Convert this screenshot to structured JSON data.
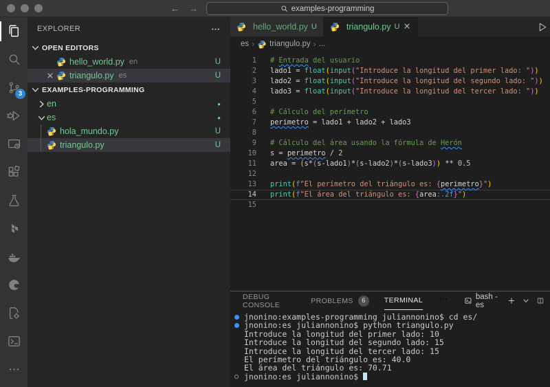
{
  "colors": {
    "untracked_green": "#73C991",
    "badge_blue": "#2F86D1",
    "squiggle_info_blue": "#3794FF",
    "terminal_decoration_blue": "#3794ff",
    "comment": "#6A9955",
    "string": "#CE9178",
    "builtin_function": "#4EC9B0",
    "number": "#B5CEA8",
    "bracket_level1": "#FFD700",
    "bracket_level2": "#DA70D6",
    "fstring_prefix": "#569CD6"
  },
  "title_bar": {
    "search_value": "examples-programming"
  },
  "activity_bar": {
    "items": [
      {
        "name": "explorer",
        "icon": "files",
        "active": true
      },
      {
        "name": "search",
        "icon": "search"
      },
      {
        "name": "source-control",
        "icon": "source-control",
        "badge": "3"
      },
      {
        "name": "run-and-debug",
        "icon": "debug"
      },
      {
        "name": "remote-explorer",
        "icon": "remote"
      },
      {
        "name": "extensions",
        "icon": "extensions"
      },
      {
        "name": "testing",
        "icon": "beaker"
      },
      {
        "name": "terraform",
        "icon": "terraform"
      },
      {
        "name": "docker",
        "icon": "docker"
      },
      {
        "name": "edge-tools",
        "icon": "edge"
      },
      {
        "name": "code-runner",
        "icon": "file-gear"
      },
      {
        "name": "external-terminal",
        "icon": "terminal-box"
      },
      {
        "name": "more-views",
        "icon": "ellipsis"
      }
    ]
  },
  "sidebar": {
    "title": "EXPLORER",
    "open_editors": {
      "label": "OPEN EDITORS",
      "rows": [
        {
          "file": "hello_world.py",
          "desc": "en",
          "badge": "U",
          "selected": false
        },
        {
          "file": "triangulo.py",
          "desc": "es",
          "badge": "U",
          "selected": true,
          "close": true
        }
      ]
    },
    "workspace": {
      "label": "EXAMPLES-PROGRAMMING",
      "rows": [
        {
          "kind": "folder",
          "file": "en",
          "expanded": false,
          "badge": "●"
        },
        {
          "kind": "folder",
          "file": "es",
          "expanded": true,
          "badge": "●"
        },
        {
          "kind": "file",
          "file": "hola_mundo.py",
          "badge": "U",
          "child": true
        },
        {
          "kind": "file",
          "file": "triangulo.py",
          "badge": "U",
          "child": true,
          "selected": true
        }
      ]
    }
  },
  "editor": {
    "tabs": [
      {
        "label": "hello_world.py",
        "badge": "U",
        "active": false
      },
      {
        "label": "triangulo.py",
        "badge": "U",
        "active": true,
        "close": true
      }
    ],
    "breadcrumb": [
      "es",
      "triangulo.py",
      "..."
    ],
    "current_line": 14,
    "code_lines": [
      {
        "n": 1,
        "tokens": [
          [
            "# ",
            "cm"
          ],
          [
            "Entrada",
            "cm",
            true
          ],
          [
            " del usuario",
            "cm"
          ]
        ]
      },
      {
        "n": 2,
        "tokens": [
          [
            "lado1 = ",
            "v"
          ],
          [
            "float",
            "fn"
          ],
          [
            "(",
            "b1"
          ],
          [
            "input",
            "fn"
          ],
          [
            "(",
            "b2"
          ],
          [
            "\"Introduce la longitud del primer lado: \"",
            "str"
          ],
          [
            ")",
            "b2"
          ],
          [
            ")",
            "b1"
          ]
        ]
      },
      {
        "n": 3,
        "tokens": [
          [
            "lado2 = ",
            "v"
          ],
          [
            "float",
            "fn"
          ],
          [
            "(",
            "b1"
          ],
          [
            "input",
            "fn"
          ],
          [
            "(",
            "b2"
          ],
          [
            "\"Introduce la longitud del segundo lado: \"",
            "str"
          ],
          [
            ")",
            "b2"
          ],
          [
            ")",
            "b1"
          ]
        ]
      },
      {
        "n": 4,
        "tokens": [
          [
            "lado3 = ",
            "v"
          ],
          [
            "float",
            "fn"
          ],
          [
            "(",
            "b1"
          ],
          [
            "input",
            "fn"
          ],
          [
            "(",
            "b2"
          ],
          [
            "\"Introduce la longitud del tercer lado: \"",
            "str"
          ],
          [
            ")",
            "b2"
          ],
          [
            ")",
            "b1"
          ]
        ]
      },
      {
        "n": 5,
        "tokens": []
      },
      {
        "n": 6,
        "tokens": [
          [
            "# Cálculo del perímetro",
            "cm"
          ]
        ]
      },
      {
        "n": 7,
        "tokens": [
          [
            "perimetro",
            "v",
            true
          ],
          [
            " = lado1 + lado2 + lado3",
            "v"
          ]
        ]
      },
      {
        "n": 8,
        "tokens": []
      },
      {
        "n": 9,
        "tokens": [
          [
            "# Cálculo del área usando la fórmula de ",
            "cm"
          ],
          [
            "Herón",
            "cm",
            true
          ]
        ]
      },
      {
        "n": 10,
        "tokens": [
          [
            "s = ",
            "v"
          ],
          [
            "perimetro",
            "v",
            true
          ],
          [
            " / ",
            "v"
          ],
          [
            "2",
            "num"
          ]
        ]
      },
      {
        "n": 11,
        "tokens": [
          [
            "area = ",
            "v"
          ],
          [
            "(",
            "b1"
          ],
          [
            "s*",
            "v"
          ],
          [
            "(",
            "b2"
          ],
          [
            "s-lado1",
            "v"
          ],
          [
            ")",
            "b2"
          ],
          [
            "*",
            "v"
          ],
          [
            "(",
            "b2"
          ],
          [
            "s-lado2",
            "v"
          ],
          [
            ")",
            "b2"
          ],
          [
            "*",
            "v"
          ],
          [
            "(",
            "b2"
          ],
          [
            "s-lado3",
            "v"
          ],
          [
            ")",
            "b2"
          ],
          [
            ")",
            "b1"
          ],
          [
            " ** ",
            "v"
          ],
          [
            "0.5",
            "num"
          ]
        ]
      },
      {
        "n": 12,
        "tokens": []
      },
      {
        "n": 13,
        "tokens": [
          [
            "print",
            "fn"
          ],
          [
            "(",
            "b1"
          ],
          [
            "f",
            "kw"
          ],
          [
            "\"El perímetro del triángulo es: ",
            "str"
          ],
          [
            "{",
            "b2"
          ],
          [
            "perimetro",
            "v",
            true
          ],
          [
            "}",
            "b2"
          ],
          [
            "\"",
            "str"
          ],
          [
            ")",
            "b1"
          ]
        ]
      },
      {
        "n": 14,
        "tokens": [
          [
            "print",
            "fn"
          ],
          [
            "(",
            "b1"
          ],
          [
            "f",
            "kw"
          ],
          [
            "\"El área del triángulo es: ",
            "str"
          ],
          [
            "{",
            "b2"
          ],
          [
            "area",
            "v"
          ],
          [
            ":.2f",
            "fmt"
          ],
          [
            "}",
            "b2"
          ],
          [
            "\"",
            "str"
          ],
          [
            ")",
            "b1"
          ]
        ]
      },
      {
        "n": 15,
        "tokens": []
      }
    ]
  },
  "panel": {
    "tabs": [
      {
        "label": "DEBUG CONSOLE"
      },
      {
        "label": "PROBLEMS",
        "badge": "6"
      },
      {
        "label": "TERMINAL",
        "active": true
      }
    ],
    "shell_label": "bash - es",
    "terminal_lines": [
      {
        "dec": "filled",
        "text": "jnonino:examples-programming juliannonino$ cd es/"
      },
      {
        "dec": "filled",
        "text": "jnonino:es juliannonino$ python triangulo.py"
      },
      {
        "text": "Introduce la longitud del primer lado: 10"
      },
      {
        "text": "Introduce la longitud del segundo lado: 15"
      },
      {
        "text": "Introduce la longitud del tercer lado: 15"
      },
      {
        "text": "El perímetro del triángulo es: 40.0"
      },
      {
        "text": "El área del triángulo es: 70.71"
      },
      {
        "dec": "open",
        "text": "jnonino:es juliannonino$ ",
        "cursor": true
      }
    ]
  }
}
